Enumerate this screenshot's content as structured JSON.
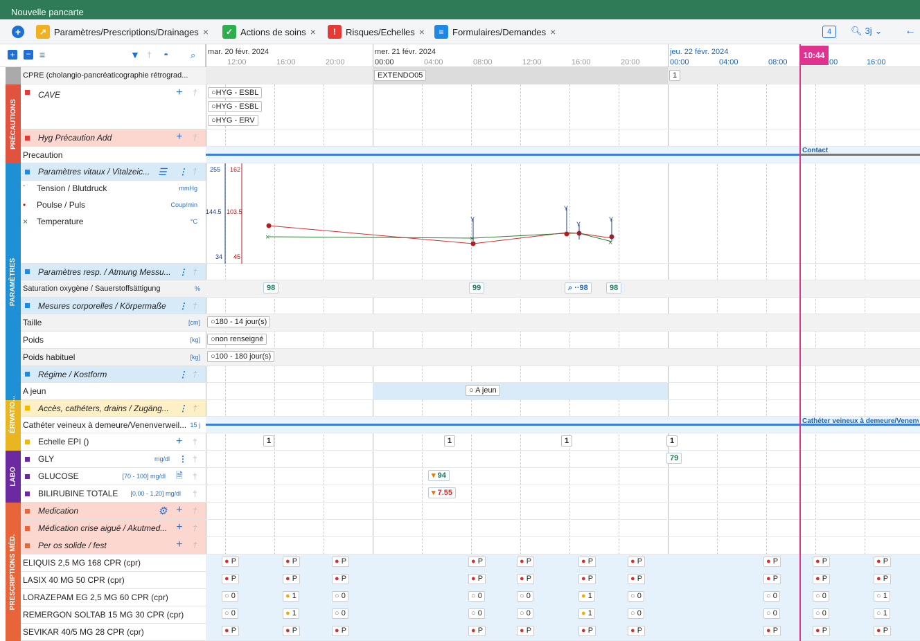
{
  "window": {
    "title": "Nouvelle pancarte"
  },
  "tabs": [
    {
      "label": "Paramètres/Prescriptions/Drainages",
      "icon": "chart-icon",
      "color": "#f0b020"
    },
    {
      "label": "Actions de soins",
      "icon": "check-box-icon",
      "color": "#2fae4e"
    },
    {
      "label": "Risques/Echelles",
      "icon": "warning-icon",
      "color": "#e53935"
    },
    {
      "label": "Formulaires/Demandes",
      "icon": "document-icon",
      "color": "#1e88e5"
    }
  ],
  "toprIght": {
    "badge": "4",
    "zoom": "3j"
  },
  "dates": [
    {
      "label": "mar. 20 févr. 2024"
    },
    {
      "label": "mer. 21 févr. 2024"
    },
    {
      "label": "jeu. 22 févr. 2024"
    }
  ],
  "hours": [
    "12:00",
    "16:00",
    "20:00",
    "00:00",
    "04:00",
    "08:00",
    "12:00",
    "16:00",
    "20:00",
    "00:00",
    "04:00",
    "08:00",
    "00",
    "16:00"
  ],
  "now": "10:44",
  "sections": {
    "precautions": "PRÉCAUTIONS",
    "parametres": "PARAMÈTRES",
    "derivation": "DÉRIVATIO...",
    "labo": "LABO",
    "prescriptions": "PRESCRIPTIONS MÉD."
  },
  "rows": {
    "cpre": "CPRE (cholangio-pancréaticographie rétrograd...",
    "cave": "CAVE",
    "hyg": "Hyg Précaution Add",
    "precaution": "Precaution",
    "vitaux": "Paramètres vitaux / Vitalzeic...",
    "tension": "Tension / Blutdruck",
    "tension_unit": "mmHg",
    "pouls": "Poulse / Puls",
    "pouls_unit": "Coup/min",
    "temp": "Temperature",
    "temp_unit": "°C",
    "resp": "Paramètres resp. / Atmung Messu...",
    "sat": "Saturation oxygène / Sauerstoffsättigung",
    "sat_unit": "%",
    "corpo": "Mesures corporelles / Körpermaße",
    "taille": "Taille",
    "taille_unit": "[cm]",
    "poids": "Poids",
    "poids_unit": "[kg]",
    "poids_hab": "Poids habituel",
    "poids_hab_unit": "[kg]",
    "regime": "Régime / Kostform",
    "ajeun": "A jeun",
    "acces": "Accès, cathéters, drains / Zugäng...",
    "catheter": "Cathéter veineux à demeure/Venenverweil...",
    "catheter_badge": "15 j",
    "epi": "Echelle EPI ()",
    "gly": "GLY",
    "gly_unit": "mg/dl",
    "glucose": "GLUCOSE",
    "glucose_unit": "[70 - 100] mg/dl",
    "bili": "BILIRUBINE TOTALE",
    "bili_unit": "[0,00 - 1,20] mg/dl",
    "medication": "Medication",
    "crise": "Médication crise aiguë / Akutmed...",
    "peros": "Per os solide / fest",
    "eliquis": "ELIQUIS 2,5 MG 168 CPR (cpr)",
    "lasix": "LASIX 40 MG 50 CPR (cpr)",
    "lorazepam": "LORAZEPAM EG 2,5 MG 60 CPR (cpr)",
    "remergon": "REMERGON SOLTAB 15 MG 30 CPR (cpr)",
    "sevikar": "SEVIKAR 40/5 MG 28 CPR (cpr)"
  },
  "chart": {
    "scale_tension": [
      "255",
      "144.5",
      "34"
    ],
    "scale_pouls": [
      "162",
      "103.5",
      "45"
    ]
  },
  "cells": {
    "extendo": "EXTENDO05",
    "one": "1",
    "cave_items": [
      "○HYG - ESBL",
      "○HYG - ESBL",
      "○HYG - ERV"
    ],
    "contact": "Contact",
    "sat_values": [
      "98",
      "99",
      "98",
      "98"
    ],
    "taille": "○180 - 14 jour(s)",
    "poids": "○non renseigné",
    "poids_hab": "○100 - 180 jour(s)",
    "ajeun": "○ A jeun",
    "catheter": "Cathéter veineux à demeure/Venenverw",
    "epi_values": [
      "1",
      "1",
      "1",
      "1"
    ],
    "gly_value": "79",
    "glucose_value": "94",
    "bili_value": "7.55"
  },
  "med_P": "P",
  "med_0": "0",
  "med_1": "1",
  "colors": {
    "precautions": "#e0533f",
    "parametres": "#1f8fd6",
    "derivation": "#e8b620",
    "labo": "#6b2aa0",
    "prescriptions": "#e8653a",
    "now": "#e0338f"
  }
}
